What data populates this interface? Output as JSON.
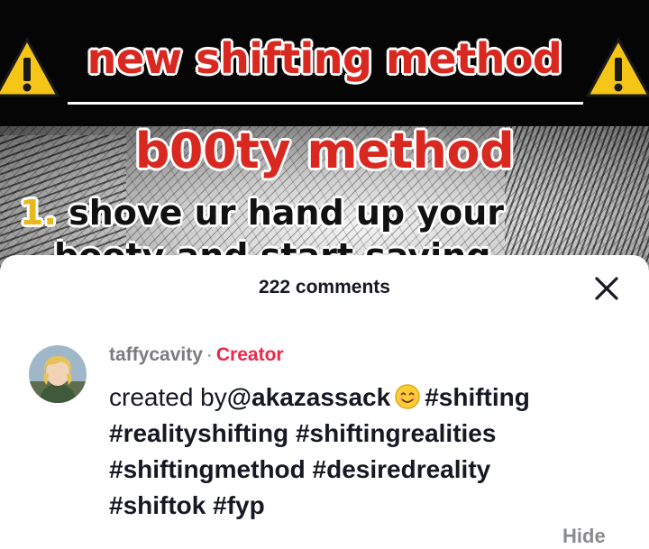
{
  "video": {
    "caption_line1": "new shifting method",
    "caption_line2": "b00ty method",
    "step_number": "1.",
    "step_text": "shove ur hand up your",
    "step_text_cut": "booty and start saying"
  },
  "comments_sheet": {
    "title": "222 comments",
    "close_icon": "close-icon"
  },
  "caption_comment": {
    "username": "taffycavity",
    "separator": "·",
    "badge": "Creator",
    "text_prefix": "created by",
    "mention": "@akazassack",
    "emoji": "smiling-face-icon",
    "hashtags_line1": "#shifting",
    "line2": "#realityshifting #shiftingrealities",
    "line3": "#shiftingmethod #desiredreality",
    "line4": "#shiftok #fyp"
  },
  "hide_label": "Hide",
  "colors": {
    "creator_badge": "#e8294a",
    "caption_red": "#d9281f",
    "warning_yellow": "#f5c518"
  }
}
